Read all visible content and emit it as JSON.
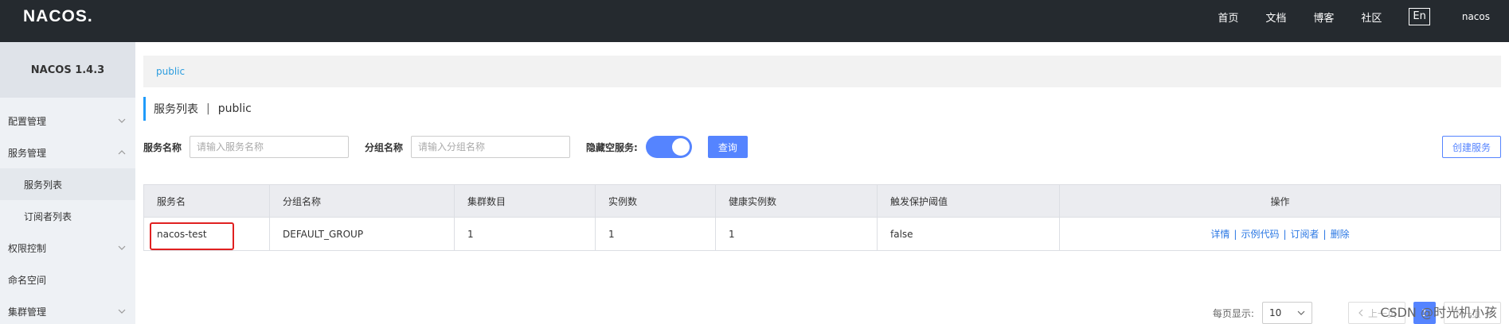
{
  "header": {
    "logo": "NACOS.",
    "nav": [
      "首页",
      "文档",
      "博客",
      "社区"
    ],
    "lang": "En",
    "user": "nacos"
  },
  "sidebar": {
    "version": "NACOS 1.4.3",
    "items": [
      {
        "label": "配置管理",
        "icon": "chevron-down-icon"
      },
      {
        "label": "服务管理",
        "icon": "chevron-up-icon"
      },
      {
        "label": "服务列表"
      },
      {
        "label": "订阅者列表"
      },
      {
        "label": "权限控制",
        "icon": "chevron-down-icon"
      },
      {
        "label": "命名空间"
      },
      {
        "label": "集群管理",
        "icon": "chevron-down-icon"
      }
    ]
  },
  "main": {
    "namespace_crumb": "public",
    "title": "服务列表",
    "title_sep": "|",
    "title_ns": "public",
    "filters": {
      "service_label": "服务名称",
      "service_placeholder": "请输入服务名称",
      "group_label": "分组名称",
      "group_placeholder": "请输入分组名称",
      "hide_empty_label": "隐藏空服务:",
      "query_label": "查询"
    },
    "create_label": "创建服务",
    "table": {
      "headers": [
        "服务名",
        "分组名称",
        "集群数目",
        "实例数",
        "健康实例数",
        "触发保护阈值",
        "操作"
      ],
      "rows": [
        {
          "name": "nacos-test",
          "group": "DEFAULT_GROUP",
          "clusters": "1",
          "instances": "1",
          "healthy": "1",
          "threshold": "false",
          "ops": [
            "详情",
            "示例代码",
            "订阅者",
            "删除"
          ]
        }
      ]
    },
    "pager": {
      "page_size_label": "每页显示:",
      "page_size": "10",
      "prev": "上一页",
      "current": "1",
      "next": "下一页"
    }
  },
  "watermark": "CSDN @时光机小孩"
}
